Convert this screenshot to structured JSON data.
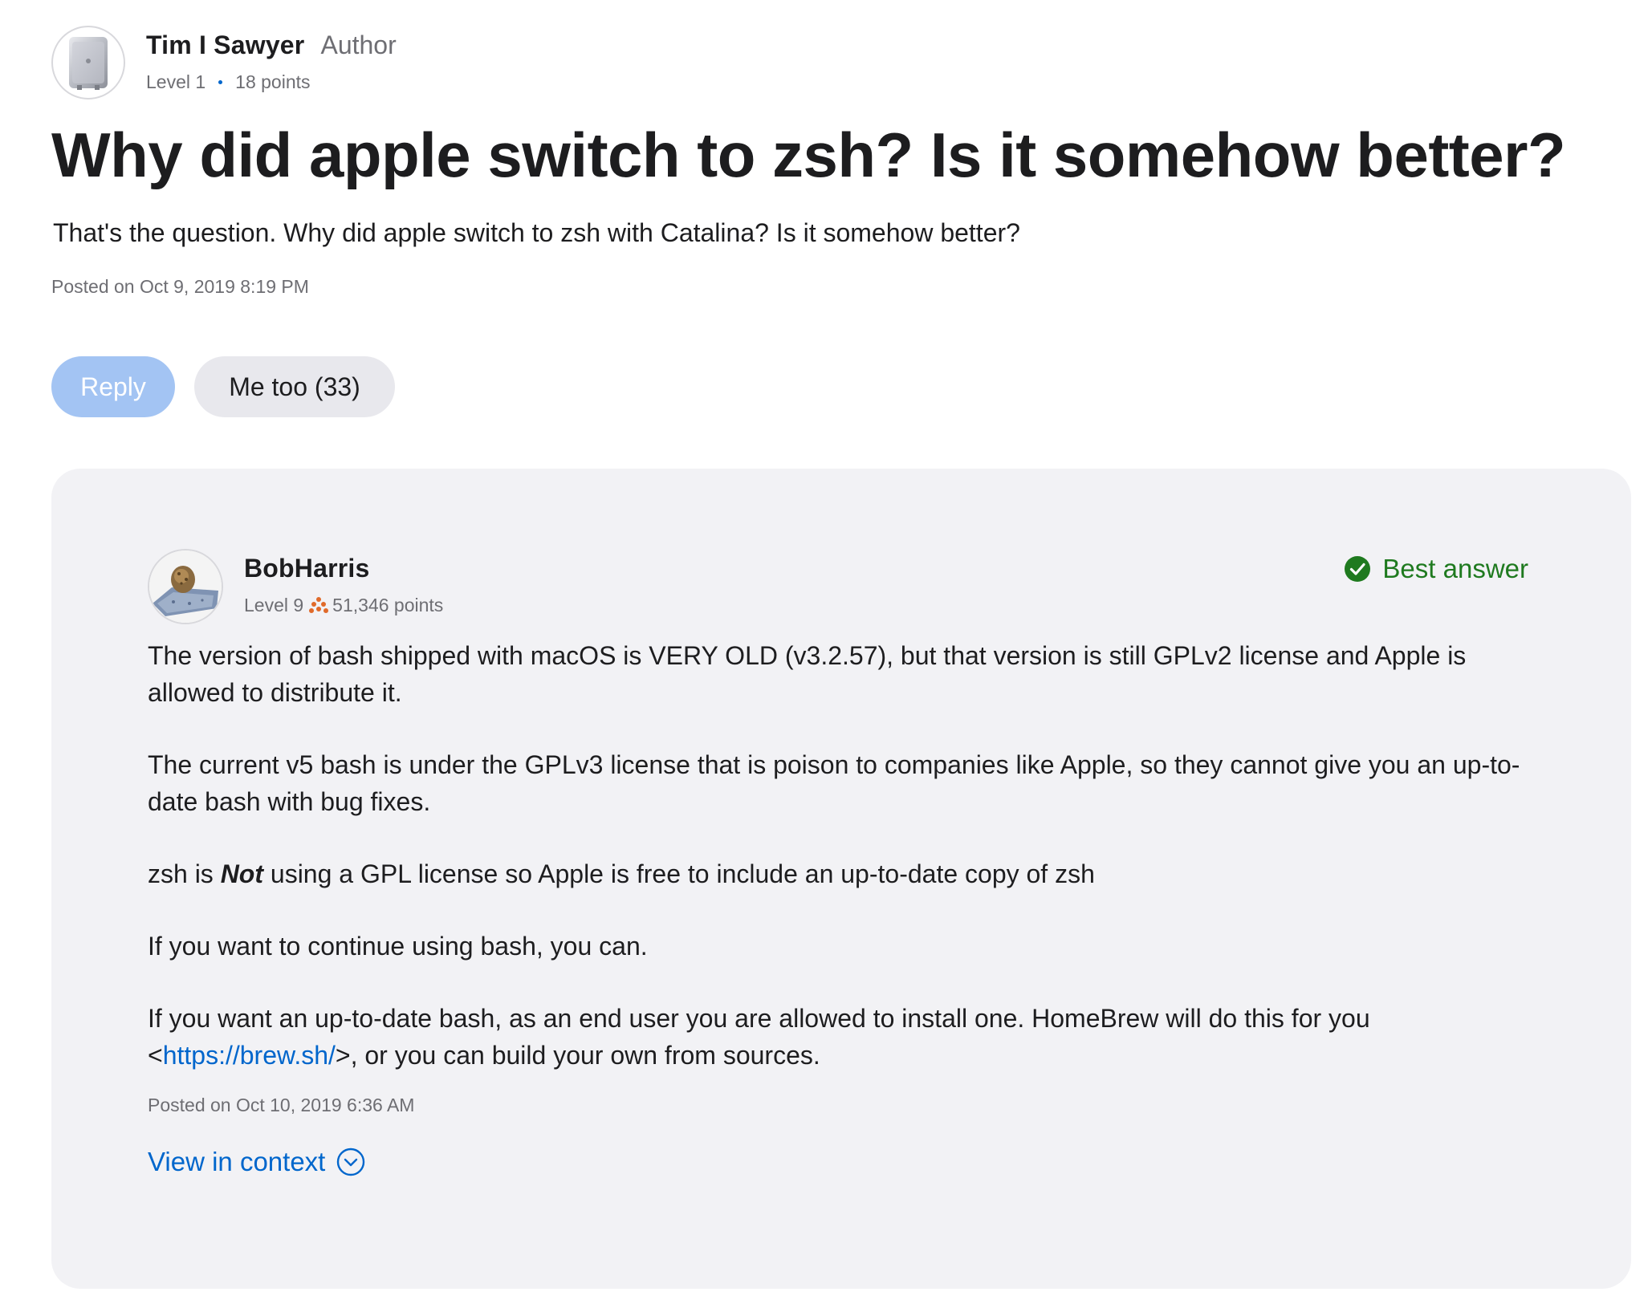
{
  "question": {
    "author": {
      "name": "Tim I Sawyer",
      "role": "Author",
      "level": "Level 1",
      "points": "18 points",
      "avatar_icon": "mac-pro-avatar-icon"
    },
    "title": "Why did apple switch to zsh? Is it somehow better?",
    "body": "That's the question. Why did apple switch to zsh with Catalina? Is it somehow better?",
    "posted": "Posted on Oct 9, 2019 8:19 PM"
  },
  "actions": {
    "reply_label": "Reply",
    "me_too_label": "Me too (33)"
  },
  "answer": {
    "author": {
      "name": "BobHarris",
      "level": "Level 9",
      "points": "51,346 points",
      "avatar_icon": "rock-avatar-icon",
      "badge_icon": "level-badge-icon"
    },
    "best_answer_label": "Best answer",
    "paragraphs": {
      "p1": "The version of bash shipped with macOS is VERY OLD (v3.2.57), but that version is still GPLv2 license and Apple is allowed to distribute it.",
      "p2": "The current v5 bash is under the GPLv3 license that is poison to companies like Apple, so they cannot give you an up-to-date bash with bug fixes.",
      "p3_pre": "zsh is ",
      "p3_emph": "Not",
      "p3_post": " using a GPL license so Apple is free to include an up-to-date copy of zsh",
      "p4": "If you want to continue using bash, you can.",
      "p5_pre": "If you want an up-to-date bash, as an end user you are allowed to install one.  HomeBrew will do this for you <",
      "p5_link": "https://brew.sh/",
      "p5_post": ">, or you can build your own from sources."
    },
    "posted": "Posted on Oct 10, 2019 6:36 AM",
    "view_in_context_label": "View in context"
  },
  "colors": {
    "accent_blue": "#0066cc",
    "reply_button": "#a3c4f3",
    "best_answer_green": "#1f7a1f",
    "card_background": "#f2f2f5"
  }
}
